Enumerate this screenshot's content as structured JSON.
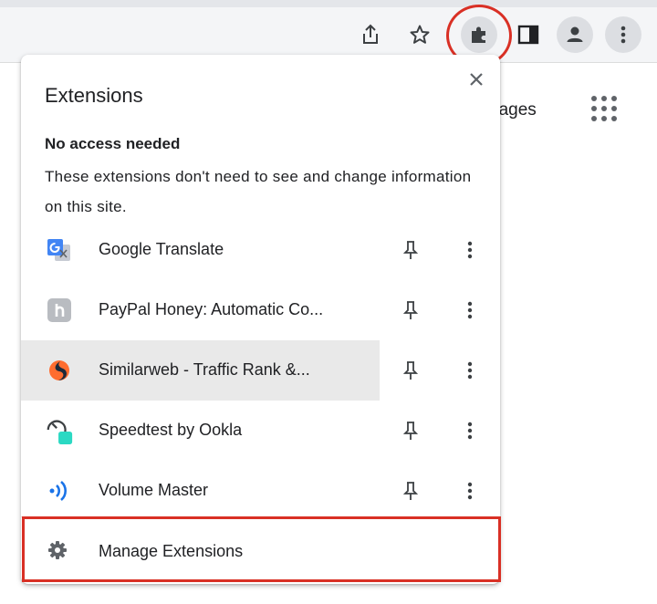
{
  "toolbar": {
    "icons": [
      "share-icon",
      "bookmark-star-icon",
      "extensions-puzzle-icon",
      "side-panel-icon",
      "profile-icon",
      "more-vert-icon"
    ]
  },
  "page": {
    "images_link_fragment": "nages"
  },
  "popup": {
    "title": "Extensions",
    "section_heading": "No access needed",
    "section_description": "These extensions don't need to see and change information on this site.",
    "extensions": [
      {
        "name": "Google Translate",
        "icon": "google-translate-icon"
      },
      {
        "name": "PayPal Honey: Automatic Co...",
        "icon": "paypal-honey-icon"
      },
      {
        "name": "Similarweb - Traffic Rank &...",
        "icon": "similarweb-icon"
      },
      {
        "name": "Speedtest by Ookla",
        "icon": "speedtest-icon"
      },
      {
        "name": "Volume Master",
        "icon": "volume-master-icon"
      }
    ],
    "manage_label": "Manage Extensions"
  },
  "colors": {
    "highlight": "#d93025",
    "hover_row": "#e9e9e9",
    "toolbar_bg": "#f4f5f7"
  }
}
